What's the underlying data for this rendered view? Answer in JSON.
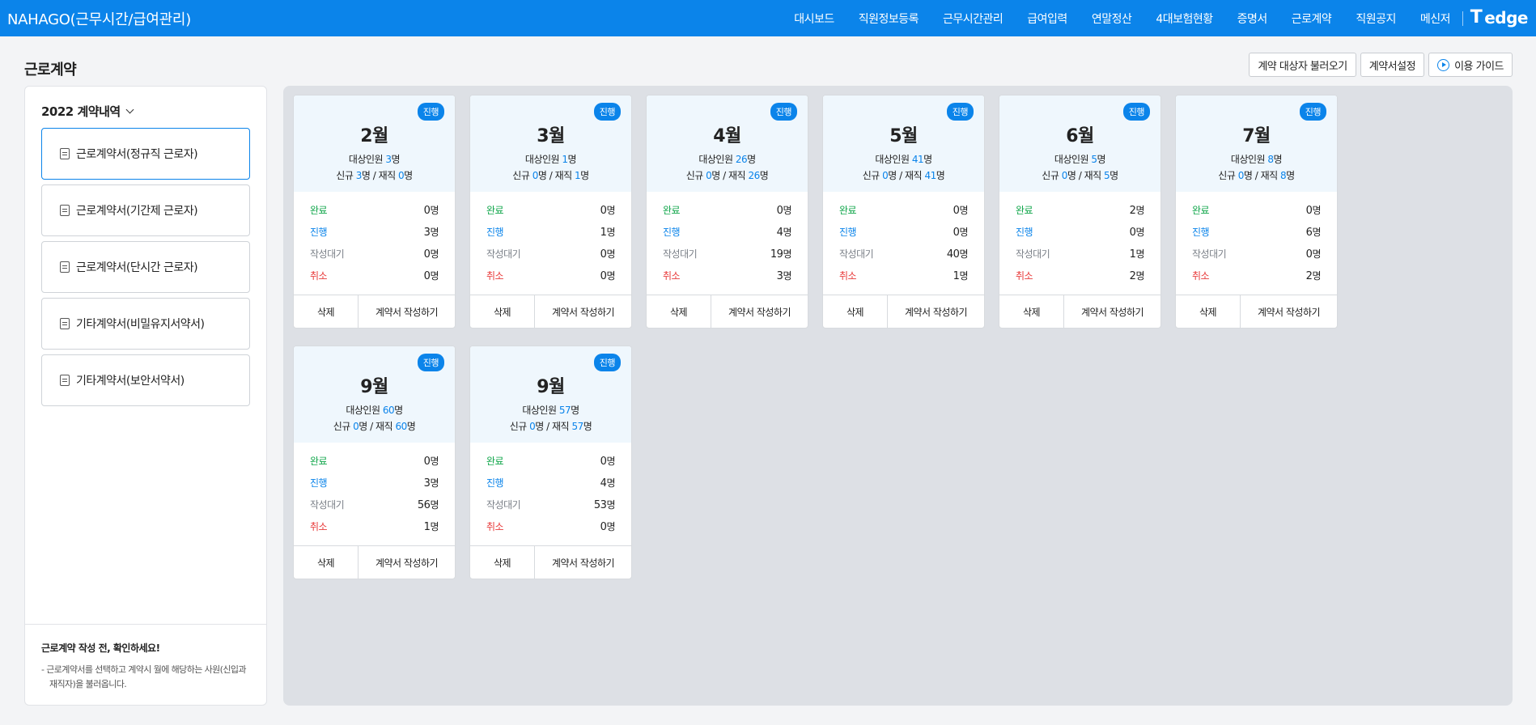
{
  "app": {
    "title": "NAHAGO(근무시간/급여관리)"
  },
  "nav": [
    {
      "label": "대시보드"
    },
    {
      "label": "직원정보등록"
    },
    {
      "label": "근무시간관리"
    },
    {
      "label": "급여입력"
    },
    {
      "label": "연말정산"
    },
    {
      "label": "4대보험현황"
    },
    {
      "label": "증명서"
    },
    {
      "label": "근로계약"
    },
    {
      "label": "직원공지"
    },
    {
      "label": "메신저"
    }
  ],
  "brand": {
    "mark": "T",
    "label": "edge"
  },
  "page": {
    "title": "근로계약"
  },
  "toolbar": {
    "load_targets": "계약 대상자 불러오기",
    "settings": "계약서설정",
    "guide": "이용 가이드"
  },
  "sidebar": {
    "year_label": "2022 계약내역",
    "items": [
      {
        "label": "근로계약서(정규직 근로자)"
      },
      {
        "label": "근로계약서(기간제 근로자)"
      },
      {
        "label": "근로계약서(단시간 근로자)"
      },
      {
        "label": "기타계약서(비밀유지서약서)"
      },
      {
        "label": "기타계약서(보안서약서)"
      }
    ],
    "notice_title": "근로계약 작성 전, 확인하세요!",
    "notice_text": "- 근로계약서를 선택하고 계약시 월에 해당하는 사원(신입과 재직자)을 불러옵니다."
  },
  "labels": {
    "target": "대상인원",
    "new": "신규",
    "current": "재직",
    "unit": "명",
    "done": "완료",
    "progress": "진행",
    "waiting": "작성대기",
    "cancel": "취소",
    "delete": "삭제",
    "write": "계약서 작성하기"
  },
  "cards": [
    {
      "month": "2월",
      "badge": "진행",
      "target": "3",
      "new": "3",
      "current": "0",
      "done": "0",
      "progress": "3",
      "waiting": "0",
      "cancel": "0"
    },
    {
      "month": "3월",
      "badge": "진행",
      "target": "1",
      "new": "0",
      "current": "1",
      "done": "0",
      "progress": "1",
      "waiting": "0",
      "cancel": "0"
    },
    {
      "month": "4월",
      "badge": "진행",
      "target": "26",
      "new": "0",
      "current": "26",
      "done": "0",
      "progress": "4",
      "waiting": "19",
      "cancel": "3"
    },
    {
      "month": "5월",
      "badge": "진행",
      "target": "41",
      "new": "0",
      "current": "41",
      "done": "0",
      "progress": "0",
      "waiting": "40",
      "cancel": "1"
    },
    {
      "month": "6월",
      "badge": "진행",
      "target": "5",
      "new": "0",
      "current": "5",
      "done": "2",
      "progress": "0",
      "waiting": "1",
      "cancel": "2"
    },
    {
      "month": "7월",
      "badge": "진행",
      "target": "8",
      "new": "0",
      "current": "8",
      "done": "0",
      "progress": "6",
      "waiting": "0",
      "cancel": "2"
    },
    {
      "month": "9월",
      "badge": "진행",
      "target": "60",
      "new": "0",
      "current": "60",
      "done": "0",
      "progress": "3",
      "waiting": "56",
      "cancel": "1"
    },
    {
      "month": "9월",
      "badge": "진행",
      "target": "57",
      "new": "0",
      "current": "57",
      "done": "0",
      "progress": "4",
      "waiting": "53",
      "cancel": "0"
    }
  ]
}
